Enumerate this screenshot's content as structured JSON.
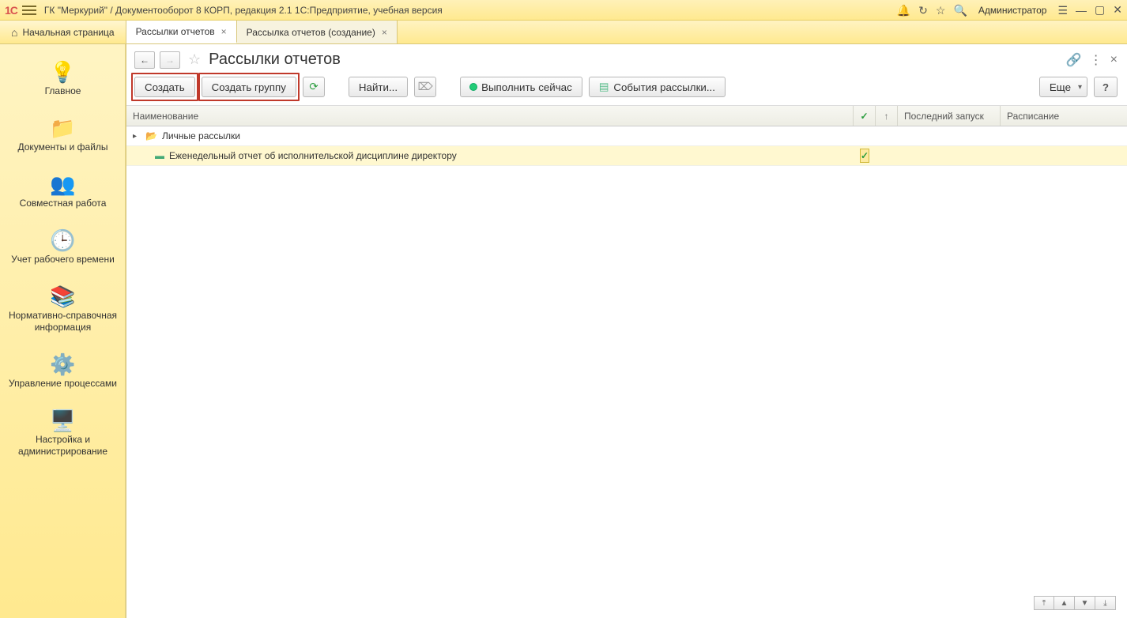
{
  "titlebar": {
    "app_title": "ГК \"Меркурий\" / Документооборот 8 КОРП, редакция 2.1 1С:Предприятие, учебная версия",
    "user": "Администратор"
  },
  "tabs": {
    "home": "Начальная страница",
    "items": [
      {
        "label": "Рассылки отчетов",
        "active": true
      },
      {
        "label": "Рассылка отчетов (создание)",
        "active": false
      }
    ]
  },
  "sidebar": {
    "items": [
      {
        "icon": "💡",
        "label": "Главное"
      },
      {
        "icon": "📁",
        "label": "Документы и файлы"
      },
      {
        "icon": "👥",
        "label": "Совместная работа"
      },
      {
        "icon": "🕒",
        "label": "Учет рабочего времени"
      },
      {
        "icon": "📚",
        "label": "Нормативно-справочная информация"
      },
      {
        "icon": "⚙️",
        "label": "Управление процессами"
      },
      {
        "icon": "🖥️",
        "label": "Настройка и администрирование"
      }
    ]
  },
  "page": {
    "title": "Рассылки отчетов"
  },
  "toolbar": {
    "create": "Создать",
    "create_group": "Создать группу",
    "find": "Найти...",
    "run_now": "Выполнить сейчас",
    "events": "События рассылки...",
    "more": "Еще",
    "help": "?"
  },
  "grid": {
    "columns": {
      "name": "Наименование",
      "check": "✓",
      "sort": "↑",
      "last_run": "Последний запуск",
      "schedule": "Расписание"
    },
    "group_row": {
      "label": "Личные рассылки"
    },
    "item_row": {
      "label": "Еженедельный отчет об исполнительской дисциплине директору",
      "checked": true
    }
  }
}
